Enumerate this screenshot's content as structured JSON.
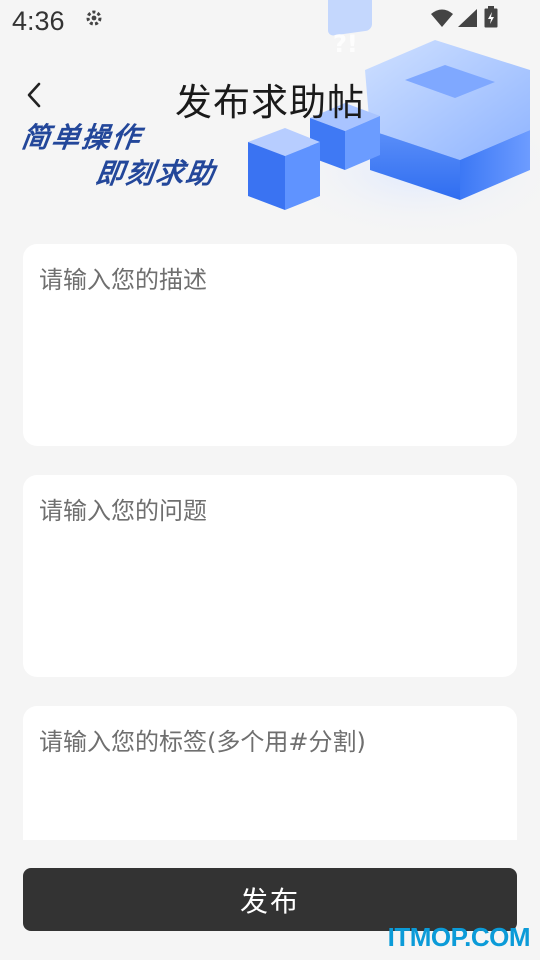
{
  "status_bar": {
    "time": "4:36",
    "icons": [
      "gear-icon",
      "wifi-icon",
      "signal-icon",
      "battery-icon"
    ]
  },
  "header": {
    "title": "发布求助帖",
    "back_icon": "chevron-left-icon",
    "slogan_line1": "简单操作",
    "slogan_line2": "即刻求助",
    "decoration_text": "?!"
  },
  "form": {
    "description_placeholder": "请输入您的描述",
    "question_placeholder": "请输入您的问题",
    "tags_placeholder": "请输入您的标签(多个用#分割)"
  },
  "actions": {
    "publish_label": "发布"
  },
  "watermark": "ITMOP.COM",
  "colors": {
    "background": "#f5f5f5",
    "card": "#ffffff",
    "button": "#333333",
    "accent_blue": "#3f7ef5",
    "slogan": "#23479a",
    "watermark": "#0b9bd8"
  }
}
